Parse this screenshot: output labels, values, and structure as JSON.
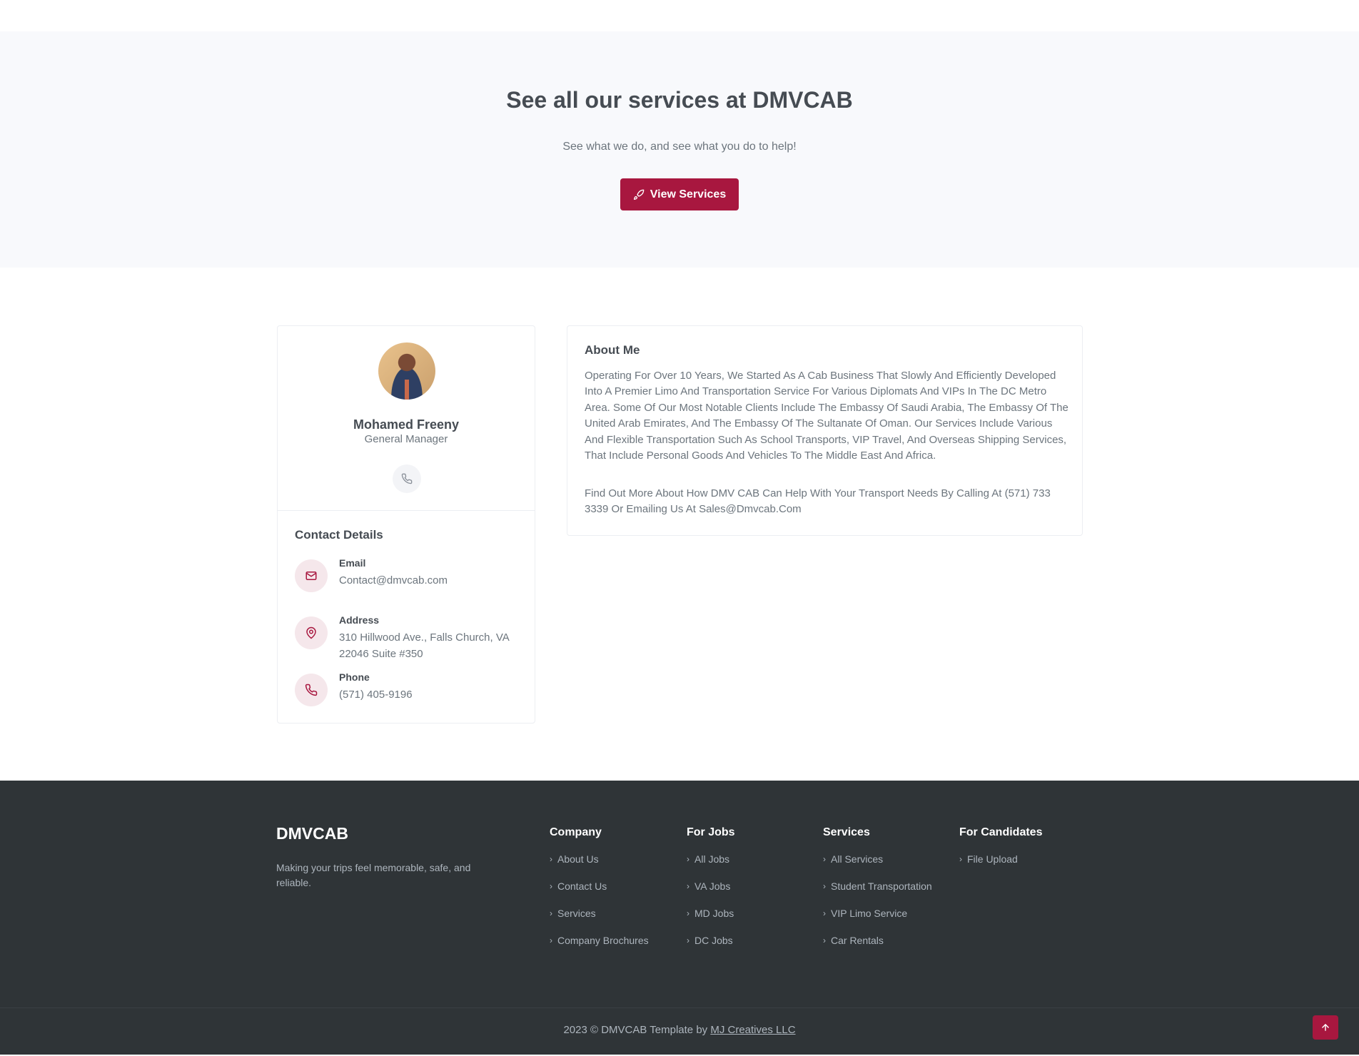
{
  "cta": {
    "title": "See all our services at DMVCAB",
    "subtitle": "See what we do, and see what you do to help!",
    "button_label": "View Services",
    "button_icon": "rocket-icon"
  },
  "profile": {
    "name": "Mohamed Freeny",
    "role": "General Manager",
    "contact_title": "Contact Details",
    "contacts": [
      {
        "label": "Email",
        "value": "Contact@dmvcab.com",
        "icon": "mail-icon"
      },
      {
        "label": "Address",
        "value": "310 Hillwood Ave., Falls Church, VA 22046 Suite #350",
        "icon": "map-pin-icon"
      },
      {
        "label": "Phone",
        "value": "(571) 405-9196",
        "icon": "phone-icon"
      }
    ]
  },
  "about": {
    "title": "About Me",
    "p1": "Operating For Over 10 Years, We Started As A Cab Business That Slowly And Efficiently Developed Into A Premier Limo And Transportation Service For Various Diplomats And VIPs In The DC Metro Area. Some Of Our Most Notable Clients Include The Embassy Of Saudi Arabia, The Embassy Of The United Arab Emirates, And The Embassy Of The Sultanate Of Oman. Our Services Include Various And Flexible Transportation Such As School Transports, VIP Travel, And Overseas Shipping Services, That Include Personal Goods And Vehicles To The Middle East And Africa.",
    "p2": "Find Out More About How DMV CAB Can Help With Your Transport Needs By Calling At (571) 733 3339 Or Emailing Us At Sales@Dmvcab.Com"
  },
  "footer": {
    "brand": "DMVCAB",
    "tagline": "Making your trips feel memorable, safe, and reliable.",
    "columns": [
      {
        "title": "Company",
        "items": [
          "About Us",
          "Contact Us",
          "Services",
          "Company Brochures"
        ]
      },
      {
        "title": "For Jobs",
        "items": [
          "All Jobs",
          "VA Jobs",
          "MD Jobs",
          "DC Jobs"
        ]
      },
      {
        "title": "Services",
        "items": [
          "All Services",
          "Student Transportation",
          "VIP Limo Service",
          "Car Rentals"
        ]
      },
      {
        "title": "For Candidates",
        "items": [
          "File Upload"
        ]
      }
    ],
    "copyright_prefix": "2023 © DMVCAB Template by",
    "copyright_link": "MJ Creatives LLC"
  },
  "colors": {
    "brand": "#a8173f",
    "footer_bg": "#2f3437",
    "cta_bg": "#f8f9fc"
  }
}
